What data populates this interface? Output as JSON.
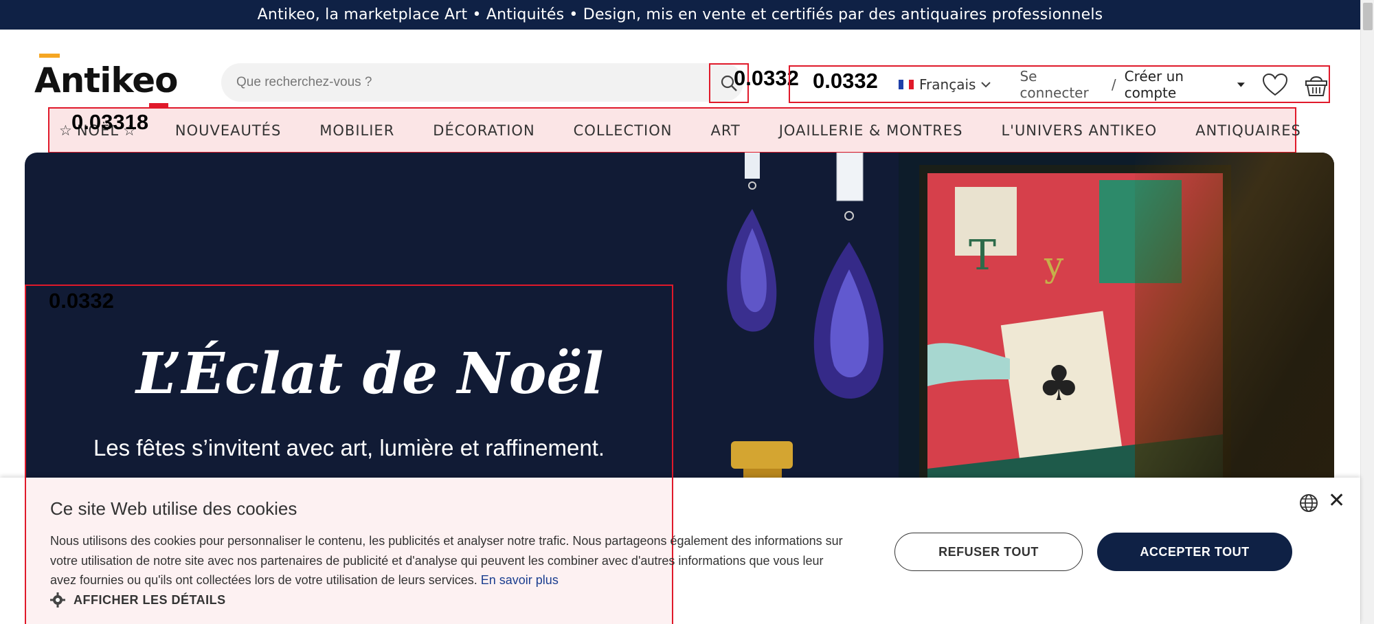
{
  "banner": {
    "text": "Antikeo, la marketplace Art • Antiquités • Design, mis en vente et certifiés par des antiquaires professionnels"
  },
  "header": {
    "logo_text": "Antikeo",
    "search_placeholder": "Que recherchez-vous ?",
    "language": "Français",
    "login": "Se connecter",
    "separator": "/",
    "create_account": "Créer un compte"
  },
  "nav": {
    "noel": "NOËL",
    "items": [
      "NOUVEAUTÉS",
      "MOBILIER",
      "DÉCORATION",
      "COLLECTION",
      "ART",
      "JOAILLERIE & MONTRES",
      "L'UNIVERS ANTIKEO",
      "ANTIQUAIRES"
    ]
  },
  "hero": {
    "title": "L’Éclat de Noël",
    "subtitle": "Les fêtes s’invitent avec art, lumière et raffinement."
  },
  "cookie": {
    "title": "Ce site Web utilise des cookies",
    "text": "Nous utilisons des cookies pour personnaliser le contenu, les publicités et analyser notre trafic. Nous partageons également des informations sur votre utilisation de notre site avec nos partenaires de publicité et d'analyse qui peuvent les combiner avec d'autres informations que vous leur avez fournies ou qu'ils ont collectées lors de votre utilisation de leurs services.",
    "link": "En savoir plus",
    "details": "AFFICHER LES DÉTAILS",
    "refuse": "REFUSER TOUT",
    "accept": "ACCEPTER TOUT"
  },
  "overlay_scores": {
    "search": "0.0332",
    "tools": "0.0332",
    "nav": "0.03318",
    "hero_card": "0.0332"
  },
  "colors": {
    "navy": "#0f2145",
    "accent_red": "#e0192a",
    "logo_orange": "#f5a623"
  }
}
